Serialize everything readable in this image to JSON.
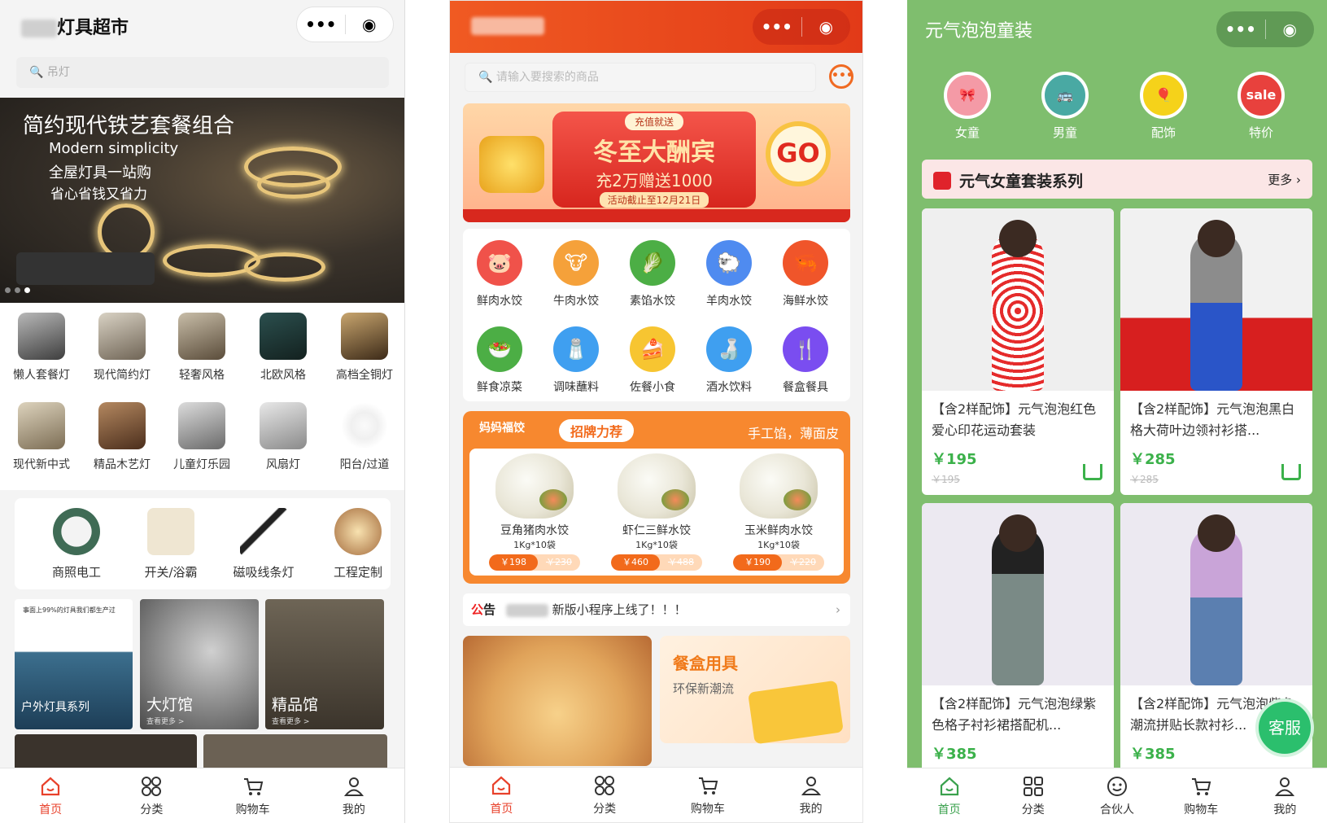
{
  "phone1": {
    "title_suffix": "灯具超市",
    "capsule": {
      "more": "•••",
      "close": "◉"
    },
    "search_placeholder": "吊灯",
    "banner": {
      "headline": "简约现代铁艺套餐组合",
      "line1": "Modern simplicity",
      "line2": "全屋灯具一站购",
      "line3": "省心省钱又省力"
    },
    "grid": [
      {
        "label": "懒人套餐灯"
      },
      {
        "label": "现代简约灯"
      },
      {
        "label": "轻奢风格"
      },
      {
        "label": "北欧风格"
      },
      {
        "label": "高档全铜灯"
      },
      {
        "label": "现代新中式"
      },
      {
        "label": "精品木艺灯"
      },
      {
        "label": "儿童灯乐园"
      },
      {
        "label": "风扇灯"
      },
      {
        "label": "阳台/过道"
      }
    ],
    "categories": [
      {
        "label": "商照电工"
      },
      {
        "label": "开关/浴霸"
      },
      {
        "label": "磁吸线条灯"
      },
      {
        "label": "工程定制"
      }
    ],
    "tiles": [
      {
        "label": "户外灯具系列",
        "sub": "事面上99%的灯具我们都生产过"
      },
      {
        "label": "大灯馆",
        "sub": "查看更多 >"
      },
      {
        "label": "精品馆",
        "sub": "查看更多 >"
      }
    ],
    "tabs": [
      {
        "label": "首页"
      },
      {
        "label": "分类"
      },
      {
        "label": "购物车"
      },
      {
        "label": "我的"
      }
    ]
  },
  "phone2": {
    "capsule": {
      "more": "•••",
      "close": "◉"
    },
    "search_placeholder": "请输入要搜索的商品",
    "banner": {
      "top": "充值就送",
      "headline": "冬至大酬宾",
      "offer": "充2万赠送1000",
      "deadline": "活动截止至12月21日",
      "go": "GO"
    },
    "icons": [
      {
        "label": "鲜肉水饺",
        "color": "#f0524a",
        "glyph": "🐷"
      },
      {
        "label": "牛肉水饺",
        "color": "#f5a13a",
        "glyph": "🐮"
      },
      {
        "label": "素馅水饺",
        "color": "#4cae45",
        "glyph": "🥬"
      },
      {
        "label": "羊肉水饺",
        "color": "#4f8bf0",
        "glyph": "🐑"
      },
      {
        "label": "海鲜水饺",
        "color": "#f0552a",
        "glyph": "🦐"
      },
      {
        "label": "鲜食凉菜",
        "color": "#4cae45",
        "glyph": "🥗"
      },
      {
        "label": "调味蘸料",
        "color": "#3f9ff0",
        "glyph": "🧂"
      },
      {
        "label": "佐餐小食",
        "color": "#f7c531",
        "glyph": "🍰"
      },
      {
        "label": "酒水饮料",
        "color": "#3f9ff0",
        "glyph": "🍶"
      },
      {
        "label": "餐盒餐具",
        "color": "#7a4df0",
        "glyph": "🍴"
      }
    ],
    "promo": {
      "brand": "妈妈福饺",
      "tag": "招牌力荐",
      "slogan": "手工馅，薄面皮",
      "items": [
        {
          "name": "豆角猪肉水饺",
          "spec": "1Kg*10袋",
          "price": "￥198",
          "old": "￥230"
        },
        {
          "name": "虾仁三鲜水饺",
          "spec": "1Kg*10袋",
          "price": "￥460",
          "old": "￥488"
        },
        {
          "name": "玉米鲜肉水饺",
          "spec": "1Kg*10袋",
          "price": "￥190",
          "old": "￥220"
        }
      ]
    },
    "notice": {
      "label_a": "公",
      "label_b": "告",
      "text": "新版小程序上线了！！！",
      "arrow": "›"
    },
    "promo_card": {
      "title": "餐盒用具",
      "subtitle": "环保新潮流"
    },
    "tabs": [
      {
        "label": "首页"
      },
      {
        "label": "分类"
      },
      {
        "label": "购物车"
      },
      {
        "label": "我的"
      }
    ]
  },
  "phone3": {
    "title": "元气泡泡童装",
    "capsule": {
      "more": "•••",
      "close": "◉"
    },
    "categories": [
      {
        "label": "女童",
        "color": "#f49aa6",
        "glyph": "🎀"
      },
      {
        "label": "男童",
        "color": "#49a9a3",
        "glyph": "🚌"
      },
      {
        "label": "配饰",
        "color": "#f5d21a",
        "glyph": "🎈"
      },
      {
        "label": "特价",
        "color": "#e8413d",
        "glyph": "sale"
      }
    ],
    "section": {
      "title": "元气女童套装系列",
      "more": "更多 ›"
    },
    "products": [
      {
        "title": "【含2样配饰】元气泡泡红色爱心印花运动套装",
        "price": "￥195",
        "old": "￥195"
      },
      {
        "title": "【含2样配饰】元气泡泡黑白格大荷叶边领衬衫搭...",
        "price": "￥285",
        "old": "￥285"
      },
      {
        "title": "【含2样配饰】元气泡泡绿紫色格子衬衫裙搭配机...",
        "price": "￥385",
        "old": ""
      },
      {
        "title": "【含2样配饰】元气泡泡紫色潮流拼贴长款衬衫...",
        "price": "￥385",
        "old": ""
      }
    ],
    "kefu": "客服",
    "tabs": [
      {
        "label": "首页"
      },
      {
        "label": "分类"
      },
      {
        "label": "合伙人"
      },
      {
        "label": "购物车"
      },
      {
        "label": "我的"
      }
    ]
  }
}
